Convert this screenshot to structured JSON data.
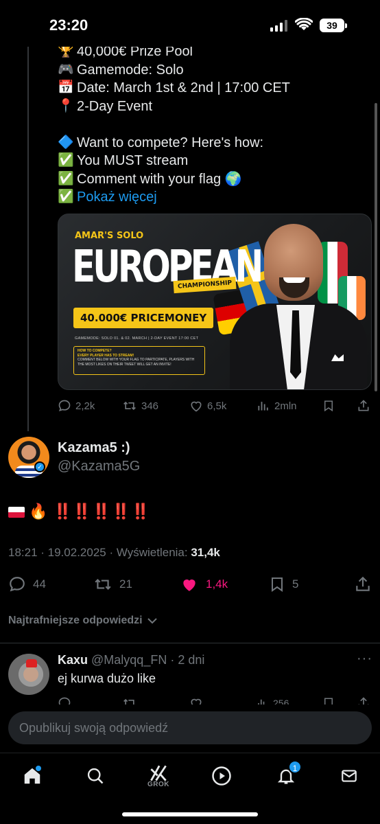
{
  "status_bar": {
    "time": "23:20",
    "battery": "39"
  },
  "quoted_post": {
    "lines": [
      {
        "emoji": "🏆",
        "text": "40,000€ Prize Pool"
      },
      {
        "emoji": "🎮",
        "text": "Gamemode: Solo"
      },
      {
        "emoji": "📅",
        "text": "Date: March 1st & 2nd | 17:00 CET"
      },
      {
        "emoji": "📍",
        "text": "2-Day Event"
      },
      {
        "emoji": "🔷",
        "text": "Want to compete? Here's how:"
      },
      {
        "emoji": "✅",
        "text": "You MUST stream"
      },
      {
        "emoji": "✅",
        "text": "Comment with your flag 🌍"
      }
    ],
    "show_more_emoji": "✅",
    "show_more": "Pokaż więcej",
    "banner": {
      "top_label": "AMAR'S SOLO",
      "headline": "EUROPEAN",
      "tag": "CHAMPIONSHIP",
      "price": "40.000€ PRICEMONEY",
      "meta": "GAMEMODE: SOLO    01. & 02. MARCH | 2-DAY EVENT    17:00 CET",
      "howto_title": "HOW TO COMPETE?",
      "howto_line1": "EVERY PLAYER HAS TO STREAM!",
      "howto_line2": "COMMENT BELOW WITH YOUR FLAG TO PARTICIPATE, PLAYERS WITH THE MOST LIKES ON THEIR TWEET WILL GET AN INVITE!"
    },
    "actions": {
      "replies": "2,2k",
      "reposts": "346",
      "likes": "6,5k",
      "views": "2mln"
    }
  },
  "main_post": {
    "author_name": "Kazama5 :)",
    "author_handle": "@Kazama5G",
    "text": "🔥 ‼️‼️‼️‼️‼️",
    "timestamp": "18:21 · 19.02.2025 · Wyświetlenia: ",
    "views": "31,4k",
    "actions": {
      "replies": "44",
      "reposts": "21",
      "likes": "1,4k",
      "bookmarks": "5"
    },
    "liked": true,
    "accent_like": "#f91880"
  },
  "replies_sort": "Najtrafniejsze odpowiedzi",
  "reply": {
    "author_name": "Kaxu",
    "author_meta": " @Malyqq_FN · 2 dni",
    "text": "ej kurwa dużo like",
    "views": "256"
  },
  "compose": {
    "placeholder": "Opublikuj swoją odpowiedź"
  },
  "bottom_nav": {
    "grok_label": "GROK",
    "notifications_badge": "1"
  }
}
